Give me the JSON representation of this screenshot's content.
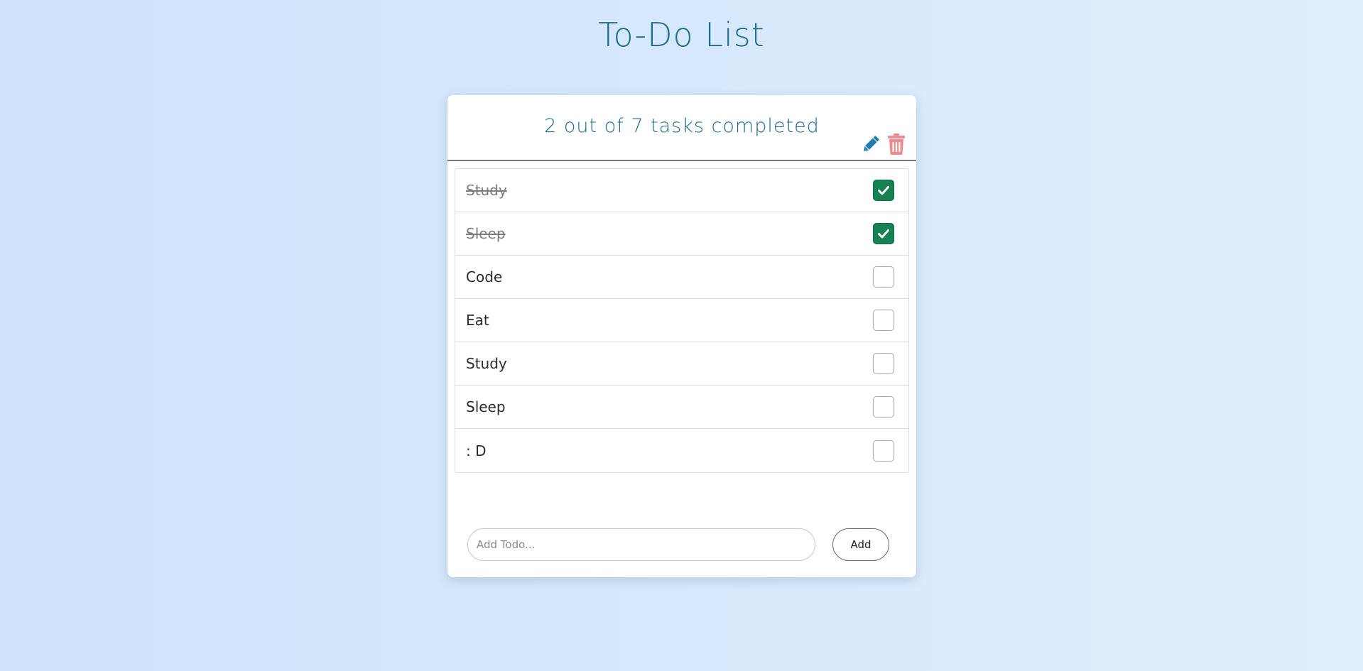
{
  "page": {
    "title": "To-Do List"
  },
  "card": {
    "progress_text": "2 out of 7 tasks completed",
    "icons": {
      "edit": "pencil-icon",
      "delete": "trash-icon"
    },
    "todos": [
      {
        "label": "Study",
        "completed": true
      },
      {
        "label": "Sleep",
        "completed": true
      },
      {
        "label": "Code",
        "completed": false
      },
      {
        "label": "Eat",
        "completed": false
      },
      {
        "label": "Study",
        "completed": false
      },
      {
        "label": "Sleep",
        "completed": false
      },
      {
        "label": ": D",
        "completed": false
      }
    ],
    "add": {
      "placeholder": "Add Todo...",
      "value": "",
      "button_label": "Add"
    }
  },
  "colors": {
    "title": "#1f6c8f",
    "edit_icon": "#1f7ab0",
    "delete_icon": "#ef8a92",
    "check_green": "#168152"
  }
}
